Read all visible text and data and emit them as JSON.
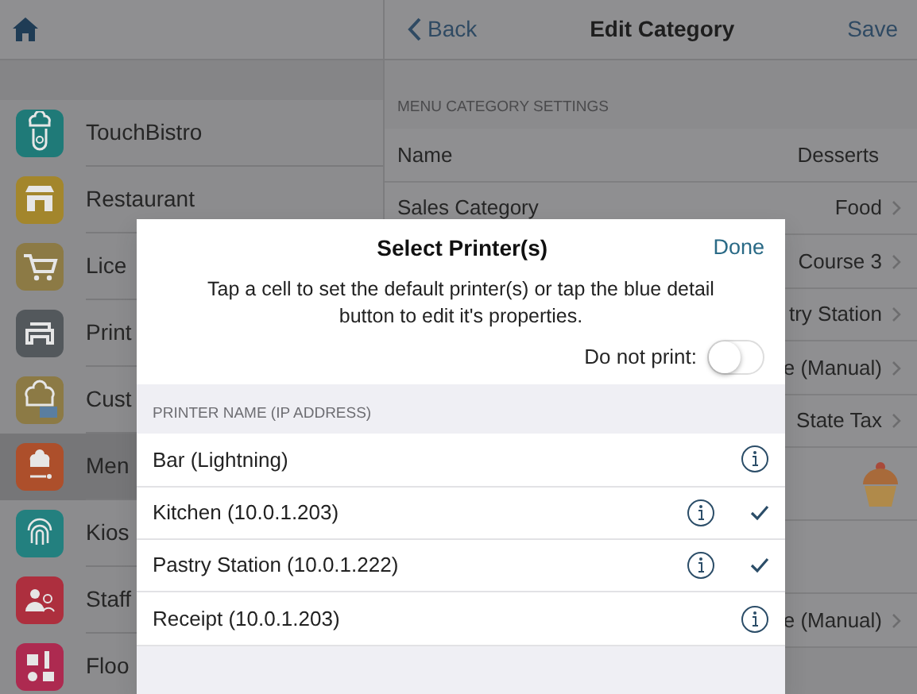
{
  "top_bar": {
    "back": "Back",
    "title": "Edit Category",
    "save": "Save"
  },
  "sidebar": {
    "items": [
      {
        "label": "TouchBistro",
        "color": "#1f7a78",
        "selected": false
      },
      {
        "label": "Restaurant",
        "color": "#a3862c",
        "selected": false
      },
      {
        "label": "Lice",
        "color": "#8c7a45",
        "selected": false
      },
      {
        "label": "Print",
        "color": "#53585c",
        "selected": false
      },
      {
        "label": "Cust",
        "color": "#8c7a45",
        "selected": false
      },
      {
        "label": "Men",
        "color": "#ad4f2b",
        "selected": true
      },
      {
        "label": "Kios",
        "color": "#23807f",
        "selected": false
      },
      {
        "label": "Staff",
        "color": "#ad2f3e",
        "selected": false
      },
      {
        "label": "Floo",
        "color": "#ad2a50",
        "selected": false
      }
    ]
  },
  "settings": {
    "header": "MENU CATEGORY SETTINGS",
    "rows": [
      {
        "kind": "value",
        "label": "Name",
        "value": "Desserts",
        "chevron": false
      },
      {
        "kind": "value",
        "label": "Sales Category",
        "value": "Food",
        "chevron": true
      },
      {
        "kind": "value",
        "value": "Course 3",
        "chevron": true
      },
      {
        "kind": "value",
        "value": "try Station",
        "chevron": true
      },
      {
        "kind": "value",
        "value": "e (Manual)",
        "chevron": true
      },
      {
        "kind": "value",
        "value": "State Tax",
        "chevron": true
      },
      {
        "kind": "image"
      },
      {
        "kind": "blank"
      },
      {
        "kind": "value",
        "value": "e (Manual)",
        "chevron": true
      }
    ]
  },
  "dialog": {
    "title": "Select Printer(s)",
    "done": "Done",
    "description": "Tap a cell to set the default printer(s) or tap the blue detail button to edit it's properties.",
    "do_not_print": {
      "label": "Do not print:",
      "on": false
    },
    "section_header": "PRINTER NAME (IP ADDRESS)",
    "printers": [
      {
        "name": "Bar (Lightning)",
        "checked": false
      },
      {
        "name": "Kitchen (10.0.1.203)",
        "checked": true
      },
      {
        "name": "Pastry Station (10.0.1.222)",
        "checked": true
      },
      {
        "name": "Receipt (10.0.1.203)",
        "checked": false
      }
    ]
  }
}
